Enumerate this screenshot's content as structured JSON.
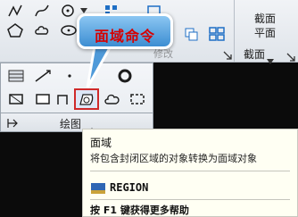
{
  "callout": {
    "text": "面域命令"
  },
  "ribbon": {
    "section_label_partial": "修改",
    "right_panel": {
      "button_line1": "截面",
      "button_line2": "平面",
      "panel_label": "截面"
    }
  },
  "draw_panel": {
    "label": "绘图"
  },
  "tooltip": {
    "title": "面域",
    "description": "将包含封闭区域的对象转换为面域对象",
    "command": "REGION",
    "help": "按 F1 键获得更多帮助"
  },
  "colors": {
    "callout_text": "#d70000",
    "highlight_border": "#cf2a2a",
    "callout_fill": "#5aa7e3"
  }
}
